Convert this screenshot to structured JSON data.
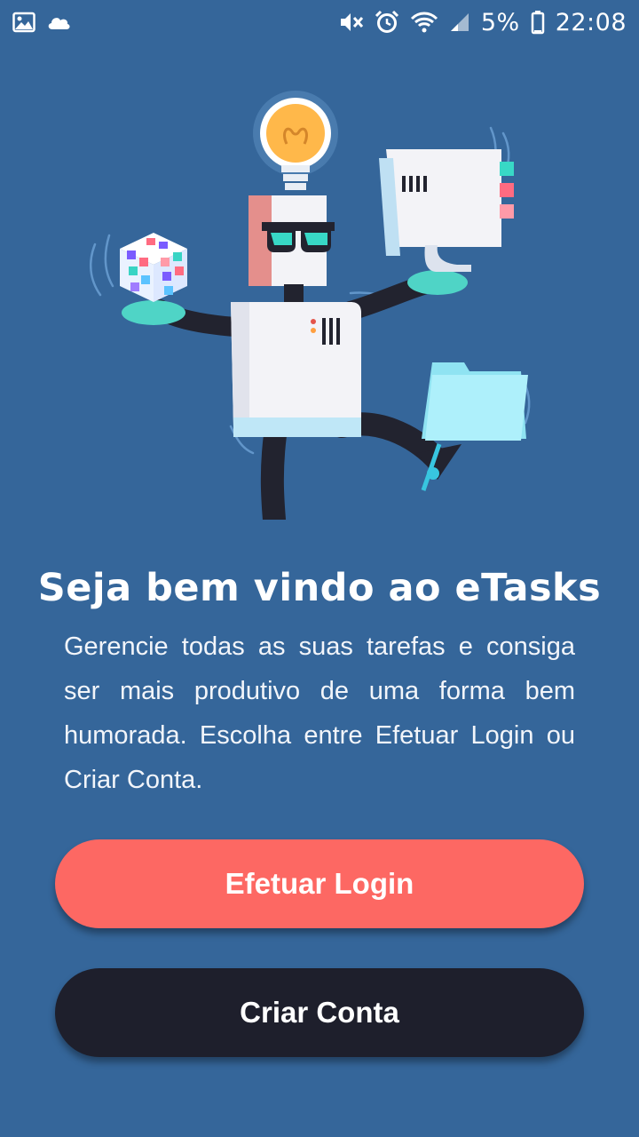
{
  "status_bar": {
    "battery_percent": "5%",
    "time": "22:08",
    "left_icons": [
      "image-notification-icon",
      "cloud-icon"
    ],
    "right_icons": [
      "mute-icon",
      "alarm-icon",
      "wifi-icon",
      "signal-icon",
      "battery-icon"
    ]
  },
  "welcome": {
    "title": "Seja bem vindo ao eTasks",
    "description": "Gerencie todas as suas tarefas e consiga ser mais produtivo de uma forma bem humorada. Escolha entre Efetuar Login ou Criar Conta."
  },
  "buttons": {
    "login_label": "Efetuar Login",
    "register_label": "Criar Conta"
  },
  "colors": {
    "background": "#35669a",
    "login_button": "#fd6863",
    "register_button": "#1e1f2c"
  },
  "illustration": {
    "icon": "robot-multitasking-illustration"
  }
}
